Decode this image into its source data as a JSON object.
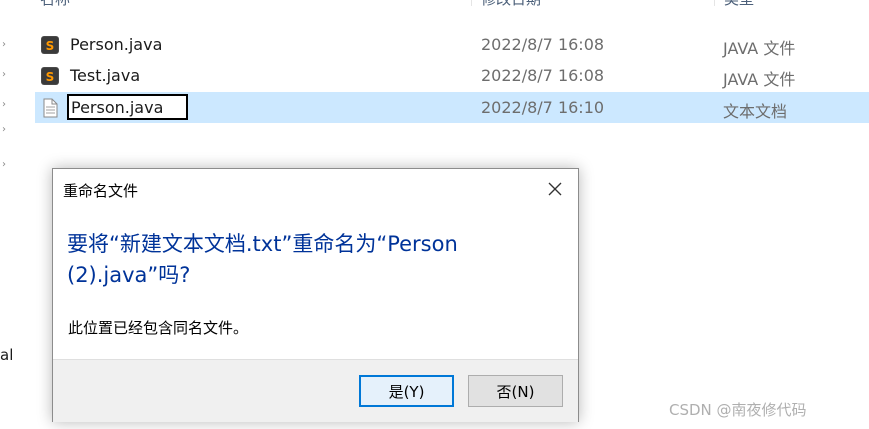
{
  "header": {
    "name_label": "名称",
    "date_label": "修改日期",
    "type_label": "类型"
  },
  "files": [
    {
      "name": "Person.java",
      "date": "2022/8/7 16:08",
      "type": "JAVA 文件",
      "icon": "sublime-file-icon"
    },
    {
      "name": "Test.java",
      "date": "2022/8/7 16:08",
      "type": "JAVA 文件",
      "icon": "sublime-file-icon"
    },
    {
      "name": "Person.java",
      "date": "2022/8/7 16:10",
      "type": "文本文档",
      "icon": "text-document-icon",
      "selected": true,
      "editing": true
    }
  ],
  "nav": {
    "partial_text": "al"
  },
  "dialog": {
    "title": "重命名文件",
    "heading": "要将“新建文本文档.txt”重命名为“Person (2).java”吗?",
    "message": "此位置已经包含同名文件。",
    "yes_label": "是(Y)",
    "no_label": "否(N)",
    "close_icon": "close-icon"
  },
  "watermark": {
    "text": "CSDN @南夜修代码"
  },
  "colors": {
    "selection": "#cce8ff",
    "dialog_heading": "#003399",
    "primary_border": "#0078d7"
  }
}
